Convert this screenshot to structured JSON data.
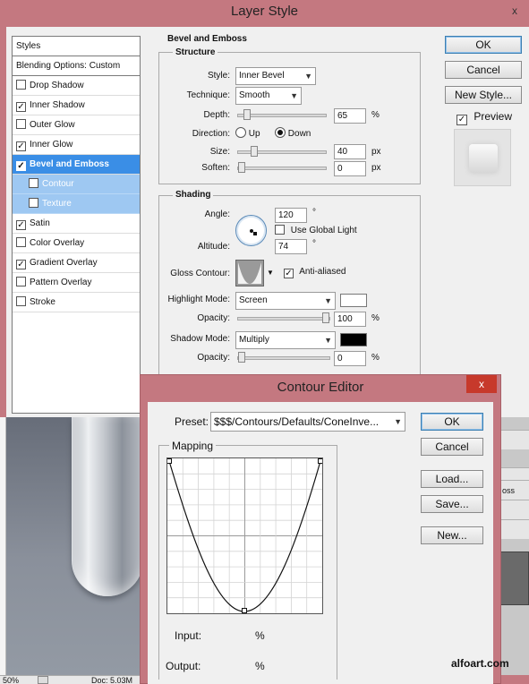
{
  "layer_style": {
    "title": "Layer Style",
    "close_glyph": "x",
    "styles_list": [
      {
        "label": "Styles",
        "kind": "head"
      },
      {
        "label": "Blending Options: Custom",
        "kind": "head"
      },
      {
        "label": "Drop Shadow",
        "checked": false
      },
      {
        "label": "Inner Shadow",
        "checked": true
      },
      {
        "label": "Outer Glow",
        "checked": false
      },
      {
        "label": "Inner Glow",
        "checked": true
      },
      {
        "label": "Bevel and Emboss",
        "checked": true,
        "selected": true
      },
      {
        "label": "Contour",
        "checked": false,
        "sub": true
      },
      {
        "label": "Texture",
        "checked": false,
        "sub": true
      },
      {
        "label": "Satin",
        "checked": true
      },
      {
        "label": "Color Overlay",
        "checked": false
      },
      {
        "label": "Gradient Overlay",
        "checked": true
      },
      {
        "label": "Pattern Overlay",
        "checked": false
      },
      {
        "label": "Stroke",
        "checked": false
      }
    ],
    "section_title": "Bevel and Emboss",
    "structure": {
      "legend": "Structure",
      "style_label": "Style:",
      "style_value": "Inner Bevel",
      "technique_label": "Technique:",
      "technique_value": "Smooth",
      "depth_label": "Depth:",
      "depth_value": "65",
      "depth_unit": "%",
      "depth_level": 0.065,
      "direction_label": "Direction:",
      "dir_up": "Up",
      "dir_down": "Down",
      "size_label": "Size:",
      "size_value": "40",
      "size_unit": "px",
      "size_level": 0.16,
      "soften_label": "Soften:",
      "soften_value": "0",
      "soften_unit": "px",
      "soften_level": 0
    },
    "shading": {
      "legend": "Shading",
      "angle_label": "Angle:",
      "angle_value": "120",
      "angle_unit": "°",
      "global_light_label": "Use Global Light",
      "altitude_label": "Altitude:",
      "altitude_value": "74",
      "altitude_unit": "°",
      "gloss_contour_label": "Gloss Contour:",
      "anti_aliased_label": "Anti-aliased",
      "highlight_mode_label": "Highlight Mode:",
      "highlight_mode_value": "Screen",
      "highlight_opacity_label": "Opacity:",
      "highlight_opacity_value": "100",
      "highlight_opacity_unit": "%",
      "highlight_opacity_level": 1.0,
      "shadow_mode_label": "Shadow Mode:",
      "shadow_mode_value": "Multiply",
      "shadow_opacity_label": "Opacity:",
      "shadow_opacity_value": "0",
      "shadow_opacity_unit": "%",
      "shadow_opacity_level": 0
    },
    "buttons": {
      "ok": "OK",
      "cancel": "Cancel",
      "new_style": "New Style...",
      "preview": "Preview"
    }
  },
  "contour_editor": {
    "title": "Contour Editor",
    "close_glyph": "x",
    "preset_label": "Preset:",
    "preset_value": "$$$/Contours/Defaults/ConeInve...",
    "mapping_legend": "Mapping",
    "input_label": "Input:",
    "input_unit": "%",
    "output_label": "Output:",
    "output_unit": "%",
    "buttons": {
      "ok": "OK",
      "cancel": "Cancel",
      "load": "Load...",
      "save": "Save...",
      "new": "New..."
    }
  },
  "status": {
    "zoom": "50%",
    "doc": "Doc: 5.03M"
  },
  "right_panel": {
    "row_text": "oss"
  },
  "watermark": "alfoart.com",
  "colors": {
    "title_bar": "#c47880",
    "selected": "#3a8ee6",
    "sub_item": "#9ec8f2",
    "close_red": "#c7392b",
    "highlight_swatch": "#ffffff",
    "shadow_swatch": "#000000"
  }
}
